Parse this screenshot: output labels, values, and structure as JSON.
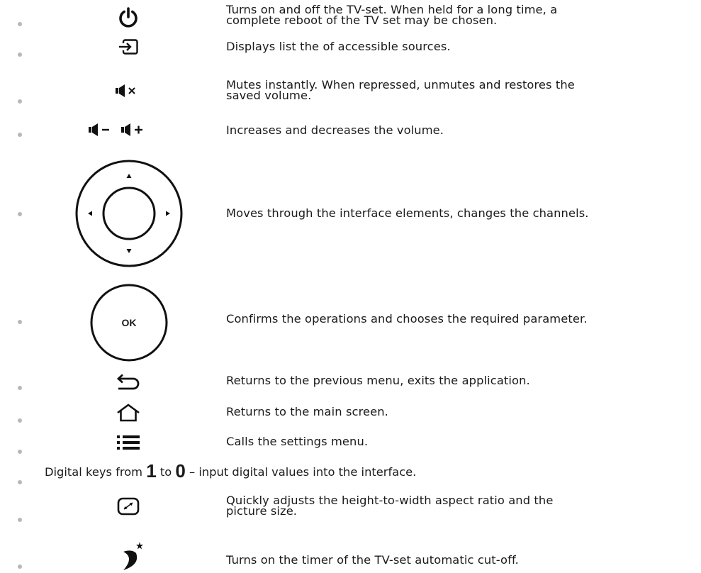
{
  "items": [
    {
      "icon": "power-icon",
      "text": "Turns on and off the TV-set. When held for a long time, a\ncomplete reboot of the TV set may be chosen."
    },
    {
      "icon": "input-source-icon",
      "text": "Displays list the of accessible sources."
    },
    {
      "icon": "mute-icon",
      "text": "Mutes instantly. When repressed, unmutes and restores the\nsaved volume."
    },
    {
      "icon": "volume-down-up-icon",
      "text": "Increases and decreases the volume."
    },
    {
      "icon": "navigation-pad-icon",
      "text": "Moves through the interface elements, changes the channels."
    },
    {
      "icon": "ok-button-icon",
      "label": "OK",
      "text": "Confirms the operations and chooses the required parameter."
    },
    {
      "icon": "back-arrow-icon",
      "text": "Returns to the previous menu, exits the application."
    },
    {
      "icon": "home-icon",
      "text": "Returns to the main screen."
    },
    {
      "icon": "settings-menu-icon",
      "text": "Calls the settings menu."
    },
    {
      "icon": "aspect-ratio-icon",
      "text": "Quickly adjusts the height-to-width aspect ratio and the\npicture size."
    },
    {
      "icon": "sleep-timer-icon",
      "text": "Turns on the timer of the TV-set automatic cut-off."
    }
  ],
  "digital_keys": {
    "prefix": "Digital keys from ",
    "first_key": "1",
    "middle": " to ",
    "last_key": "0",
    "suffix": " – input digital values into the interface."
  }
}
